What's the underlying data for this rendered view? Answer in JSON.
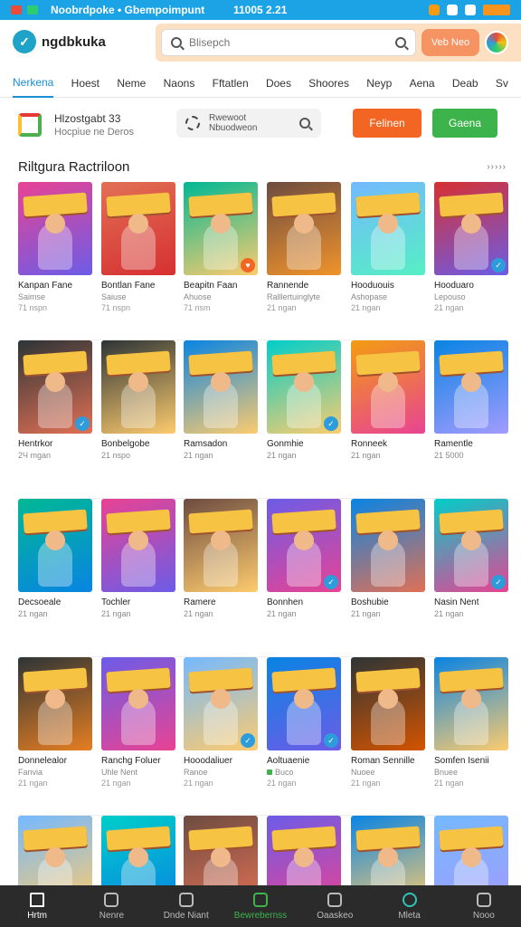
{
  "status_bar": {
    "title": "Noobrdpoke • Gbempoimpunt",
    "time": "11005 2.21"
  },
  "header": {
    "logo_text": "ngdbkuka",
    "search_placeholder": "Blisepch",
    "web_button": "Veb Neo"
  },
  "tabs": [
    "Nerkena",
    "Hoest",
    "Neme",
    "Naons",
    "Fftatlen",
    "Does",
    "Shoores",
    "Neyp",
    "Aena",
    "Deab",
    "Sv"
  ],
  "profile": {
    "name": "Hlzostgabt 33",
    "subtitle": "Hocpiue ne Deros",
    "recent_line1": "Rwewoot",
    "recent_line2": "Nbuodweon",
    "orange_button": "Felinen",
    "green_button": "Gaena"
  },
  "section": {
    "title": "Riltgura Ractriloon",
    "more": "›››››"
  },
  "games": [
    [
      {
        "title": "Kanpan Fane",
        "sub": "Saimse",
        "sub2": "71 nspn",
        "colors": [
          "#e84393",
          "#6c5ce7"
        ],
        "badge": ""
      },
      {
        "title": "Bontlan Fane",
        "sub": "Saiuse",
        "sub2": "71 nspn",
        "colors": [
          "#e17055",
          "#d63031"
        ],
        "badge": ""
      },
      {
        "title": "Beapitn Faan",
        "sub": "Ahuose",
        "sub2": "71 nsm",
        "colors": [
          "#00b894",
          "#fdcb6e"
        ],
        "badge": "orange"
      },
      {
        "title": "Rannende",
        "sub": "Ralllertuinglyte",
        "sub2": "21 ngan",
        "colors": [
          "#6d4c41",
          "#f0932b"
        ],
        "badge": ""
      },
      {
        "title": "Hooduouis",
        "sub": "Ashopase",
        "sub2": "21 ngan",
        "colors": [
          "#74b9ff",
          "#55efc4"
        ],
        "badge": ""
      },
      {
        "title": "Hooduaro",
        "sub": "Lepouso",
        "sub2": "21 ngan",
        "colors": [
          "#d63031",
          "#6c5ce7"
        ],
        "badge": "blue"
      }
    ],
    [
      {
        "title": "Hentrkor",
        "sub": "2Ч mgan",
        "sub2": "",
        "colors": [
          "#2d3436",
          "#e17055"
        ],
        "badge": "blue"
      },
      {
        "title": "Bonbelgobe",
        "sub": "21 nspo",
        "sub2": "",
        "colors": [
          "#2d3436",
          "#fdcb6e"
        ],
        "badge": ""
      },
      {
        "title": "Ramsadon",
        "sub": "21 ngan",
        "sub2": "",
        "colors": [
          "#0984e3",
          "#fdcb6e"
        ],
        "badge": ""
      },
      {
        "title": "Gonmhie",
        "sub": "21 ngan",
        "sub2": "",
        "colors": [
          "#00cec9",
          "#fdcb6e"
        ],
        "badge": "blue"
      },
      {
        "title": "Ronneek",
        "sub": "21 ngan",
        "sub2": "",
        "colors": [
          "#f39c12",
          "#e84393"
        ],
        "badge": ""
      },
      {
        "title": "Ramentle",
        "sub": "21 5000",
        "sub2": "",
        "colors": [
          "#0984e3",
          "#a29bfe"
        ],
        "badge": ""
      }
    ],
    [
      {
        "title": "Decsoeale",
        "sub": "21 ngan",
        "sub2": "",
        "colors": [
          "#00b894",
          "#0984e3"
        ],
        "badge": ""
      },
      {
        "title": "Tochler",
        "sub": "21 ngan",
        "sub2": "",
        "colors": [
          "#e84393",
          "#6c5ce7"
        ],
        "badge": ""
      },
      {
        "title": "Ramere",
        "sub": "21 ngan",
        "sub2": "",
        "colors": [
          "#6d4c41",
          "#fdcb6e"
        ],
        "badge": ""
      },
      {
        "title": "Bonnhen",
        "sub": "21 ngan",
        "sub2": "",
        "colors": [
          "#6c5ce7",
          "#e84393"
        ],
        "badge": "blue"
      },
      {
        "title": "Boshubie",
        "sub": "21 ngan",
        "sub2": "",
        "colors": [
          "#0984e3",
          "#e17055"
        ],
        "badge": ""
      },
      {
        "title": "Nasin Nent",
        "sub": "21 ngan",
        "sub2": "",
        "colors": [
          "#00cec9",
          "#e84393"
        ],
        "badge": "blue"
      }
    ],
    [
      {
        "title": "Donnelealor",
        "sub": "Fanvia",
        "sub2": "21 ngan",
        "colors": [
          "#2d3436",
          "#e67e22"
        ],
        "badge": ""
      },
      {
        "title": "Ranchg Foluer",
        "sub": "Uhle Nent",
        "sub2": "21 ngan",
        "colors": [
          "#6c5ce7",
          "#e84393"
        ],
        "badge": ""
      },
      {
        "title": "Hooodaliuer",
        "sub": "Ranoe",
        "sub2": "21 ngan",
        "colors": [
          "#74b9ff",
          "#fdcb6e"
        ],
        "badge": "blue"
      },
      {
        "title": "Aoltuaenie",
        "sub": "Buco",
        "sub2": "21 ngan",
        "colors": [
          "#0984e3",
          "#6c5ce7"
        ],
        "badge": "blue",
        "green": true
      },
      {
        "title": "Roman Sennille",
        "sub": "Nuoee",
        "sub2": "21 ngan",
        "colors": [
          "#2d3436",
          "#d35400"
        ],
        "badge": ""
      },
      {
        "title": "Somfen Isenii",
        "sub": "Bnuee",
        "sub2": "21 ngan",
        "colors": [
          "#0984e3",
          "#fdcb6e"
        ],
        "badge": ""
      }
    ],
    [
      {
        "title": "",
        "sub": "",
        "sub2": "",
        "colors": [
          "#74b9ff",
          "#fdcb6e"
        ],
        "badge": ""
      },
      {
        "title": "",
        "sub": "",
        "sub2": "",
        "colors": [
          "#00cec9",
          "#0984e3"
        ],
        "badge": ""
      },
      {
        "title": "",
        "sub": "",
        "sub2": "",
        "colors": [
          "#6d4c41",
          "#e17055"
        ],
        "badge": ""
      },
      {
        "title": "",
        "sub": "",
        "sub2": "",
        "colors": [
          "#6c5ce7",
          "#e84393"
        ],
        "badge": ""
      },
      {
        "title": "",
        "sub": "",
        "sub2": "",
        "colors": [
          "#0984e3",
          "#fdcb6e"
        ],
        "badge": ""
      },
      {
        "title": "",
        "sub": "",
        "sub2": "",
        "colors": [
          "#74b9ff",
          "#a29bfe"
        ],
        "badge": ""
      }
    ]
  ],
  "bottom_nav": [
    {
      "label": "Hrtm",
      "icon": "home-icon",
      "style": "home"
    },
    {
      "label": "Nenre",
      "icon": "search-icon",
      "style": ""
    },
    {
      "label": "Dnde Niant",
      "icon": "calendar-icon",
      "style": ""
    },
    {
      "label": "Bewrebernss",
      "icon": "gamepad-icon",
      "style": "active"
    },
    {
      "label": "Oaaskeo",
      "icon": "chat-icon",
      "style": ""
    },
    {
      "label": "Mleta",
      "icon": "bell-icon",
      "style": "teal"
    },
    {
      "label": "Nooo",
      "icon": "profile-icon",
      "style": ""
    }
  ],
  "colors": {
    "accent": "#1ba3e6",
    "orange": "#f26522",
    "green": "#3cb44b",
    "nav_bg": "#2b2b2b"
  }
}
